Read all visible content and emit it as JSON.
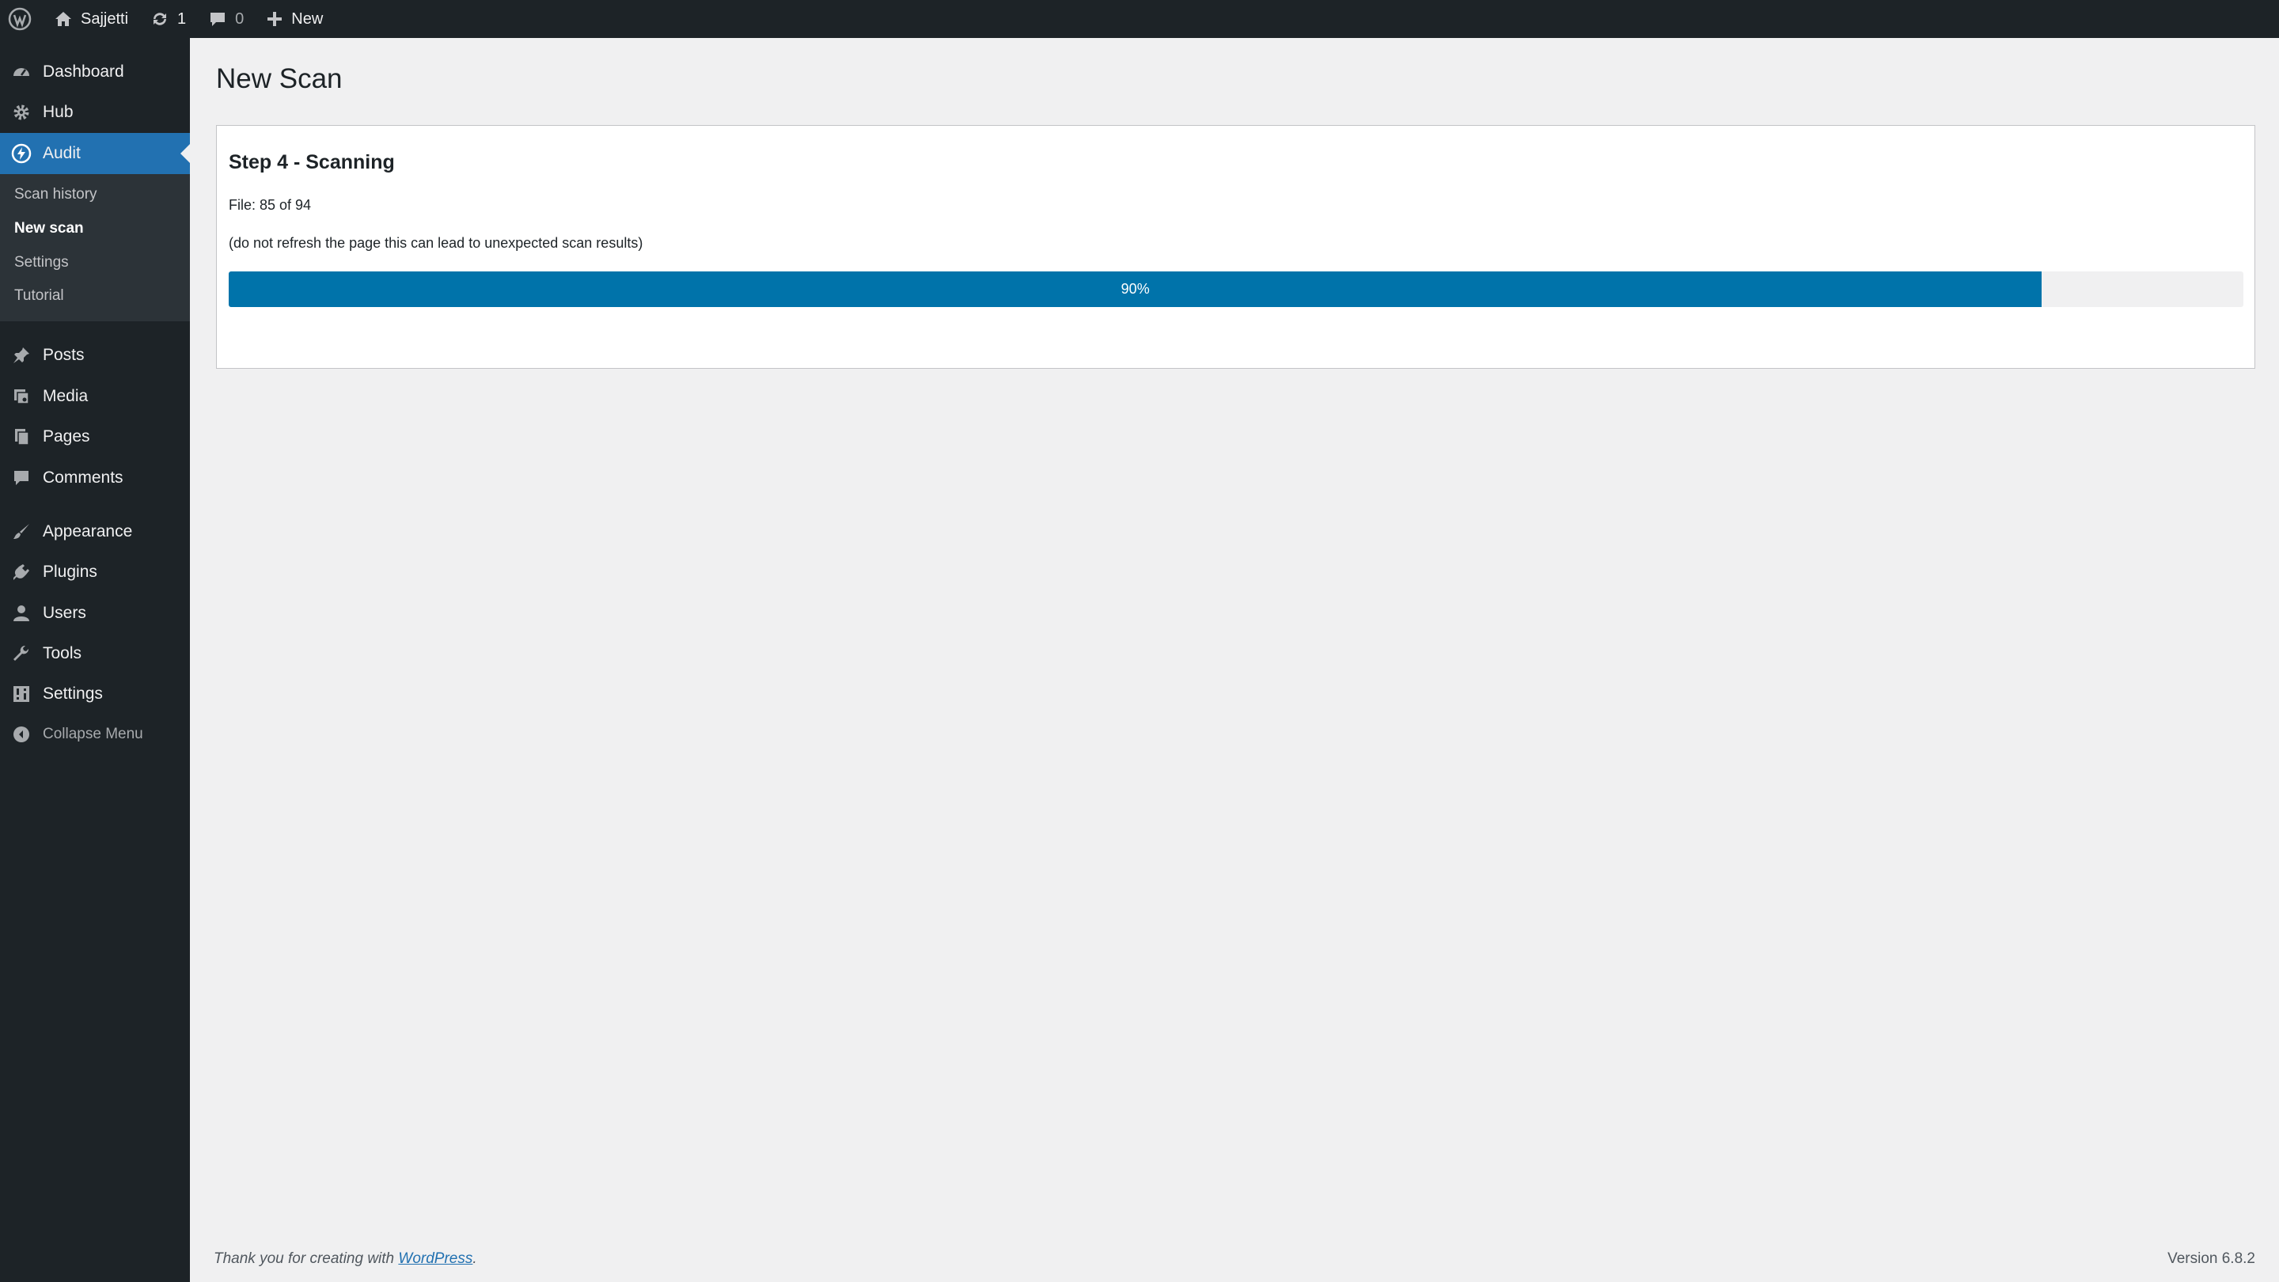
{
  "admin_bar": {
    "site_name": "Sajjetti",
    "updates_count": "1",
    "comments_count": "0",
    "new_label": "New"
  },
  "sidebar": {
    "items": [
      {
        "label": "Dashboard",
        "icon": "dashboard-icon"
      },
      {
        "label": "Hub",
        "icon": "gear-icon"
      },
      {
        "label": "Audit",
        "icon": "audit-icon",
        "current": true
      },
      {
        "label": "Posts",
        "icon": "pin-icon"
      },
      {
        "label": "Media",
        "icon": "media-icon"
      },
      {
        "label": "Pages",
        "icon": "pages-icon"
      },
      {
        "label": "Comments",
        "icon": "comment-icon"
      },
      {
        "label": "Appearance",
        "icon": "brush-icon"
      },
      {
        "label": "Plugins",
        "icon": "plugin-icon"
      },
      {
        "label": "Users",
        "icon": "user-icon"
      },
      {
        "label": "Tools",
        "icon": "wrench-icon"
      },
      {
        "label": "Settings",
        "icon": "settings-icon"
      }
    ],
    "submenu": [
      {
        "label": "Scan history"
      },
      {
        "label": "New scan",
        "active": true
      },
      {
        "label": "Settings"
      },
      {
        "label": "Tutorial"
      }
    ],
    "collapse_label": "Collapse Menu"
  },
  "main": {
    "page_title": "New Scan",
    "step_title": "Step 4 - Scanning",
    "file_progress": "File: 85 of 94",
    "warning": "(do not refresh the page this can lead to unexpected scan results)",
    "progress_percent": 90,
    "progress_label": "90%"
  },
  "footer": {
    "thanks_prefix": "Thank you for creating with ",
    "thanks_link": "WordPress",
    "thanks_suffix": ".",
    "version": "Version 6.8.2"
  },
  "colors": {
    "admin_bg": "#1d2327",
    "accent": "#2271b1",
    "progress": "#0073aa"
  }
}
